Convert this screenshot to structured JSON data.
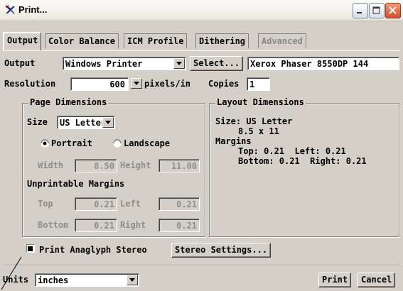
{
  "window": {
    "title": "Print..."
  },
  "tabs": [
    {
      "label": "Output",
      "state": "active"
    },
    {
      "label": "Color Balance",
      "state": "normal"
    },
    {
      "label": "ICM Profile",
      "state": "normal"
    },
    {
      "label": "Dithering",
      "state": "normal"
    },
    {
      "label": "Advanced",
      "state": "disabled"
    }
  ],
  "output": {
    "label": "Output",
    "device": "Windows Printer",
    "select_button": "Select...",
    "printer_name": "Xerox Phaser 8550DP 144"
  },
  "resolution": {
    "label": "Resolution",
    "value": "600",
    "unit": "pixels/in"
  },
  "copies": {
    "label": "Copies",
    "value": "1"
  },
  "page_dimensions": {
    "title": "Page Dimensions",
    "size_label": "Size",
    "size_value": "US Letter",
    "portrait_label": "Portrait",
    "landscape_label": "Landscape",
    "orientation": "Portrait",
    "width_label": "Width",
    "width_value": "8.50",
    "height_label": "Height",
    "height_value": "11.00",
    "margins_title": "Unprintable Margins",
    "top_label": "Top",
    "top_value": "0.21",
    "left_label": "Left",
    "left_value": "0.21",
    "bottom_label": "Bottom",
    "bottom_value": "0.21",
    "right_label": "Right",
    "right_value": "0.21"
  },
  "layout_dimensions": {
    "title": "Layout Dimensions",
    "line1": "Size: US Letter",
    "line2": "8.5 x 11",
    "line3": "Margins",
    "line4": "Top: 0.21  Left: 0.21",
    "line5": "Bottom: 0.21  Right: 0.21"
  },
  "anaglyph": {
    "label": "Print Anaglyph Stereo",
    "checked": true,
    "settings_button": "Stereo Settings..."
  },
  "units": {
    "label": "Units",
    "value": "inches"
  },
  "actions": {
    "print": "Print",
    "cancel": "Cancel"
  },
  "colors": {
    "face": "#d4d0c8",
    "close": "#d24d2c",
    "disabled_text": "#8d8d8d"
  }
}
